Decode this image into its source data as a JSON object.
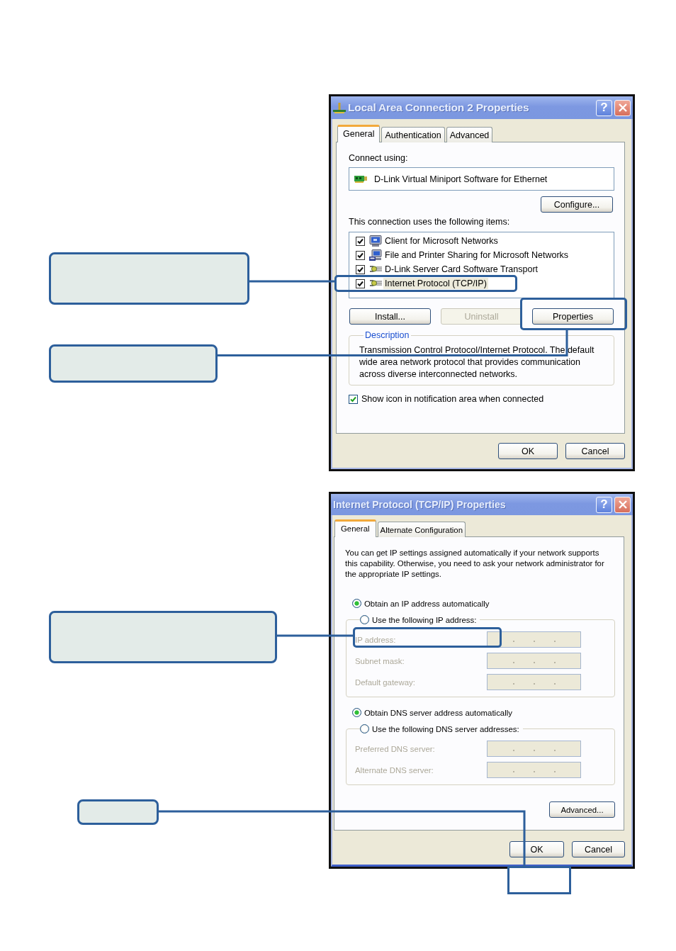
{
  "connection_dialog": {
    "title": "Local Area Connection 2 Properties",
    "help_button": "?",
    "tabs": [
      {
        "label": "General",
        "selected": true
      },
      {
        "label": "Authentication",
        "selected": false
      },
      {
        "label": "Advanced",
        "selected": false
      }
    ],
    "connect_using_label": "Connect using:",
    "adapter": "D-Link Virtual Miniport Software for Ethernet",
    "configure_button": "Configure...",
    "items_label": "This connection uses the following items:",
    "items": [
      {
        "kind": "client",
        "label": "Client for Microsoft Networks",
        "checked": true,
        "selected": false
      },
      {
        "kind": "service",
        "label": "File and Printer Sharing for Microsoft Networks",
        "checked": true,
        "selected": false
      },
      {
        "kind": "protocol",
        "label": "D-Link Server Card Software Transport",
        "checked": true,
        "selected": false
      },
      {
        "kind": "protocol",
        "label": "Internet Protocol (TCP/IP)",
        "checked": true,
        "selected": true
      }
    ],
    "item_buttons": [
      {
        "label": "Install...",
        "disabled": false
      },
      {
        "label": "Uninstall",
        "disabled": true
      },
      {
        "label": "Properties",
        "disabled": false
      }
    ],
    "description": {
      "legend": "Description",
      "text": "Transmission Control Protocol/Internet Protocol. The default wide area network protocol that provides communication across diverse interconnected networks."
    },
    "show_icon": {
      "label": "Show icon in notification area when connected",
      "checked": true
    },
    "footer_buttons": [
      "OK",
      "Cancel"
    ]
  },
  "tcpip_dialog": {
    "title": "Internet Protocol (TCP/IP) Properties",
    "help_button": "?",
    "tabs": [
      {
        "label": "General",
        "selected": true
      },
      {
        "label": "Alternate Configuration",
        "selected": false
      }
    ],
    "intro": "You can get IP settings assigned automatically if your network supports this capability. Otherwise, you need to ask your network administrator for the appropriate IP settings.",
    "ip_options": [
      {
        "label": "Obtain an IP address automatically",
        "selected": true
      },
      {
        "label": "Use the following IP address:",
        "selected": false
      }
    ],
    "ip_fields": [
      {
        "label": "IP address:",
        "disabled": true
      },
      {
        "label": "Subnet mask:",
        "disabled": true
      },
      {
        "label": "Default gateway:",
        "disabled": true
      }
    ],
    "dns_options": [
      {
        "label": "Obtain DNS server address automatically",
        "selected": true
      },
      {
        "label": "Use the following DNS server addresses:",
        "selected": false
      }
    ],
    "dns_fields": [
      {
        "label": "Preferred DNS server:",
        "disabled": true
      },
      {
        "label": "Alternate DNS server:",
        "disabled": true
      }
    ],
    "advanced_button": "Advanced...",
    "footer_buttons": [
      "OK",
      "Cancel"
    ]
  }
}
